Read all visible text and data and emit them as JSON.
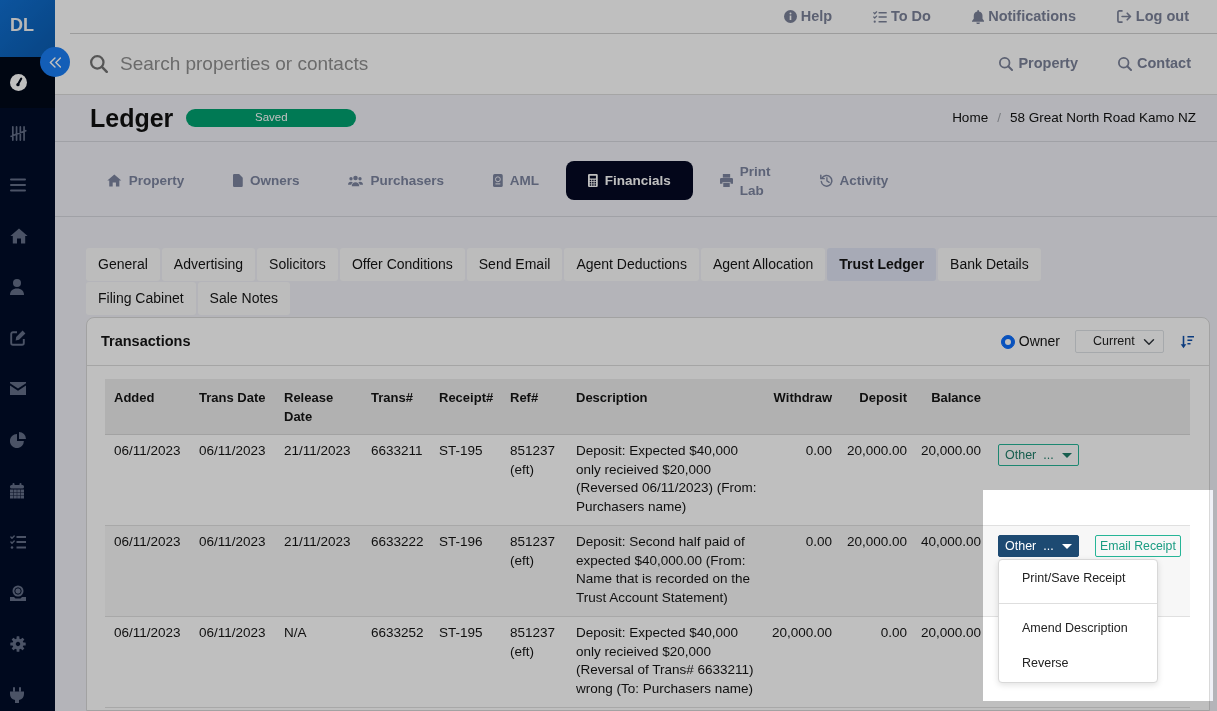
{
  "sidebar": {
    "logo": "DL",
    "items": [
      {
        "selected": true
      },
      {
        "selected": false
      },
      {
        "selected": false
      },
      {
        "selected": false
      },
      {
        "selected": false
      },
      {
        "selected": false
      },
      {
        "selected": false
      },
      {
        "selected": false
      },
      {
        "selected": false
      },
      {
        "selected": false
      },
      {
        "selected": false
      },
      {
        "selected": false
      },
      {
        "selected": false
      }
    ]
  },
  "top_links": [
    "Help",
    "To Do",
    "Notifications",
    "Log out"
  ],
  "search": {
    "placeholder": "Search properties or contacts",
    "scopes": [
      "Property",
      "Contact"
    ]
  },
  "page": {
    "title": "Ledger",
    "status": "Saved",
    "breadcrumb": {
      "items": [
        "Home",
        "58 Great North Road Kamo NZ"
      ],
      "separator": "/"
    }
  },
  "module_tabs": [
    {
      "label": "Property",
      "selected": false
    },
    {
      "label": "Owners",
      "selected": false
    },
    {
      "label": "Purchasers",
      "selected": false
    },
    {
      "label": "AML",
      "selected": false
    },
    {
      "label": "Financials",
      "selected": true
    },
    {
      "label": "Print Lab",
      "selected": false
    },
    {
      "label": "Activity",
      "selected": false
    }
  ],
  "section_tabs": [
    {
      "label": "General",
      "selected": false
    },
    {
      "label": "Advertising",
      "selected": false
    },
    {
      "label": "Solicitors",
      "selected": false
    },
    {
      "label": "Offer Conditions",
      "selected": false
    },
    {
      "label": "Send Email",
      "selected": false
    },
    {
      "label": "Agent Deductions",
      "selected": false
    },
    {
      "label": "Agent Allocation",
      "selected": false
    },
    {
      "label": "Trust Ledger",
      "selected": true
    },
    {
      "label": "Bank Details",
      "selected": false
    },
    {
      "label": "Filing Cabinet",
      "selected": false
    },
    {
      "label": "Sale Notes",
      "selected": false
    }
  ],
  "transactions": {
    "title": "Transactions",
    "account_filter": {
      "label": "Owner",
      "checked": true
    },
    "period_select": {
      "value": "Current"
    },
    "table": {
      "columns": [
        {
          "label": "Added",
          "kind": "text"
        },
        {
          "label": "Trans Date",
          "kind": "text"
        },
        {
          "label": "Release Date",
          "kind": "text"
        },
        {
          "label": "Trans#",
          "kind": "text"
        },
        {
          "label": "Receipt#",
          "kind": "text"
        },
        {
          "label": "Ref#",
          "kind": "text"
        },
        {
          "label": "Description",
          "kind": "text"
        },
        {
          "label": "Withdraw",
          "kind": "amount"
        },
        {
          "label": "Deposit",
          "kind": "amount"
        },
        {
          "label": "Balance",
          "kind": "amount"
        }
      ],
      "rows": [
        {
          "cells": [
            "06/11/2023",
            "06/11/2023",
            "21/11/2023",
            "6633211",
            "ST-195",
            "851237 (eft)",
            "Deposit: Expected $40,000 only recieived $20,000 (Reversed 06/11/2023) (From: Purchasers name)",
            "0.00",
            "20,000.00",
            "20,000.00"
          ],
          "actions": [
            {
              "kind": "dropdown",
              "label": "Other",
              "suffix": "...",
              "open": false
            }
          ]
        },
        {
          "cells": [
            "06/11/2023",
            "06/11/2023",
            "21/11/2023",
            "6633222",
            "ST-196",
            "851237 (eft)",
            "Deposit: Second half paid of expected $40,000.00 (From: Name that is recorded on the Trust Account Statement)",
            "0.00",
            "20,000.00",
            "40,000.00"
          ],
          "actions": [
            {
              "kind": "dropdown",
              "label": "Other",
              "suffix": "...",
              "open": true,
              "menu": [
                {
                  "kind": "item",
                  "label": "Print/Save Receipt"
                },
                {
                  "kind": "divider"
                },
                {
                  "kind": "item",
                  "label": "Amend Description"
                },
                {
                  "kind": "item",
                  "label": "Reverse"
                }
              ]
            },
            {
              "kind": "button",
              "label": "Email Receipt"
            }
          ]
        },
        {
          "cells": [
            "06/11/2023",
            "06/11/2023",
            "N/A",
            "6633252",
            "ST-195",
            "851237 (eft)",
            "Deposit: Expected $40,000 only recieived $20,000 (Reversal of Trans# 6633211) wrong (To: Purchasers name)",
            "20,000.00",
            "0.00",
            "20,000.00"
          ]
        }
      ]
    }
  }
}
